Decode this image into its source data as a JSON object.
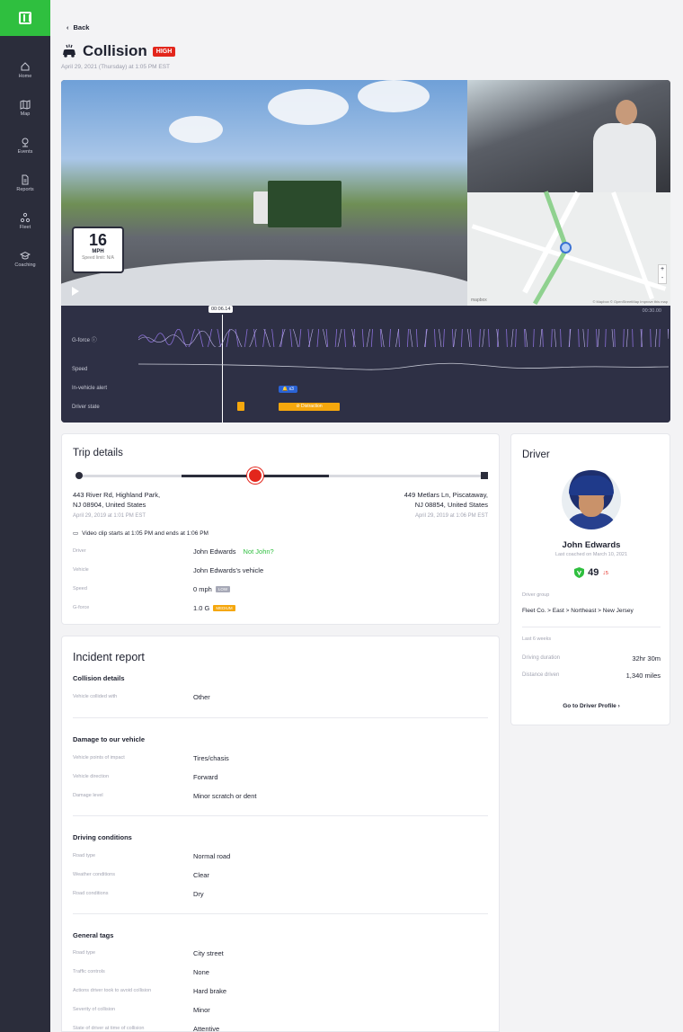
{
  "nav": {
    "items": [
      {
        "label": "Home",
        "icon": "home-icon"
      },
      {
        "label": "Map",
        "icon": "map-icon"
      },
      {
        "label": "Events",
        "icon": "pin-icon"
      },
      {
        "label": "Reports",
        "icon": "document-icon"
      },
      {
        "label": "Fleet",
        "icon": "fleet-icon"
      },
      {
        "label": "Coaching",
        "icon": "graduation-cap-icon"
      }
    ]
  },
  "header": {
    "back_label": "Back",
    "title": "Collision",
    "severity": "HIGH",
    "subtitle": "April 29, 2021 (Thursday) at 1:05 PM EST"
  },
  "video": {
    "speed_value": "16",
    "speed_unit": "MPH",
    "speed_limit": "Speed limit: N/A",
    "map_zoom_in": "+",
    "map_zoom_out": "-",
    "map_credit": "© Mapbox © OpenStreetMap Improve this map",
    "map_brand": "mapbox"
  },
  "timeline": {
    "current_time": "00:06.14",
    "end_time": "00:30.00",
    "gforce_label": "G-force",
    "speed_label": "Speed",
    "alert_label": "In-vehicle alert",
    "alert_chip": "x3",
    "driver_state_label": "Driver state",
    "driver_state_chip": "Distraction"
  },
  "trip": {
    "title": "Trip details",
    "start_address_1": "443 River Rd, Highland Park,",
    "start_address_2": "NJ 08904, United States",
    "start_time": "April 29, 2019 at 1:01 PM EST",
    "end_address_1": "449 Metlars Ln, Piscataway,",
    "end_address_2": "NJ 08854, United States",
    "end_time": "April 29, 2019 at 1:06 PM EST",
    "clip_note": "Video clip starts at 1:05 PM and ends at 1:06 PM",
    "rows": [
      {
        "key": "Driver",
        "value": "John Edwards",
        "extra": "Not John?"
      },
      {
        "key": "Vehicle",
        "value": "John Edwards's vehicle"
      },
      {
        "key": "Speed",
        "value": "0 mph",
        "chip": "LOW"
      },
      {
        "key": "G-force",
        "value": "1.0 G",
        "chip": "MEDIUM"
      }
    ]
  },
  "incident": {
    "title": "Incident report",
    "sections": [
      {
        "heading": "Collision details",
        "rows": [
          {
            "key": "Vehicle collided with",
            "value": "Other"
          }
        ]
      },
      {
        "heading": "Damage to our vehicle",
        "rows": [
          {
            "key": "Vehicle points of impact",
            "value": "Tires/chasis"
          },
          {
            "key": "Vehicle direction",
            "value": "Forward"
          },
          {
            "key": "Damage level",
            "value": "Minor scratch or dent"
          }
        ]
      },
      {
        "heading": "Driving conditions",
        "rows": [
          {
            "key": "Road type",
            "value": "Normal road"
          },
          {
            "key": "Weather conditions",
            "value": "Clear"
          },
          {
            "key": "Road conditions",
            "value": "Dry"
          }
        ]
      },
      {
        "heading": "General tags",
        "rows": [
          {
            "key": "Road type",
            "value": "City street"
          },
          {
            "key": "Traffic controls",
            "value": "None"
          },
          {
            "key": "Actions driver took to avoid collision",
            "value": "Hard brake"
          },
          {
            "key": "Severity of collision",
            "value": "Minor"
          },
          {
            "key": "State of driver at time of collision",
            "value": "Attentive"
          }
        ]
      }
    ]
  },
  "driver": {
    "title": "Driver",
    "name": "John Edwards",
    "last_coached": "Last coached on March 10, 2021",
    "score": "49",
    "score_delta": "5",
    "group_label": "Driver group",
    "group_value": "Fleet Co. > East > Northeast > New Jersey",
    "period_label": "Last 6 weeks",
    "stats": [
      {
        "key": "Driving duration",
        "value": "32hr 30m"
      },
      {
        "key": "Distance driven",
        "value": "1,340 miles"
      }
    ],
    "profile_link": "Go to Driver Profile"
  },
  "colors": {
    "sidebar": "#2b2d3b",
    "brand_green": "#2fbf3f",
    "danger": "#e3261c",
    "warning": "#f5a70d",
    "alert_blue": "#2a63d6"
  }
}
